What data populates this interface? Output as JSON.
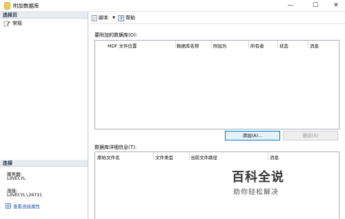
{
  "window": {
    "title": "附加数据库",
    "minimize": "—",
    "maximize": "☐",
    "close": "✕"
  },
  "left_pane": {
    "select_page_header": "选择页",
    "nav_items": [
      {
        "label": "常规",
        "icon": "wrench-page-icon"
      }
    ],
    "connection_header": "连接",
    "server_label": "服务器:",
    "server_value": "LOVECYL",
    "connection_label": "连接:",
    "connection_value": "LOVECYL\\26731",
    "view_properties_link": "查看连接属性"
  },
  "toolbar": {
    "script_label": "脚本",
    "help_label": "帮助"
  },
  "databases_section": {
    "label": "要附加的数据库(D):",
    "columns": [
      "MDF 文件位置",
      "数据库名称",
      "附加为",
      "所有者",
      "状态",
      "消息"
    ]
  },
  "buttons": {
    "add": "添加(A)...",
    "remove": "删除(R)"
  },
  "details_section": {
    "label": "数据库详细信息(T):",
    "columns": [
      "原始文件名",
      "文件类型",
      "当前文件路径",
      "消息"
    ]
  },
  "watermark": {
    "title": "百科全说",
    "subtitle": "助你轻松解决"
  },
  "colors": {
    "header_bg": "#e7ecf3",
    "link": "#1a4fb5",
    "accent_border": "#0078d7"
  }
}
